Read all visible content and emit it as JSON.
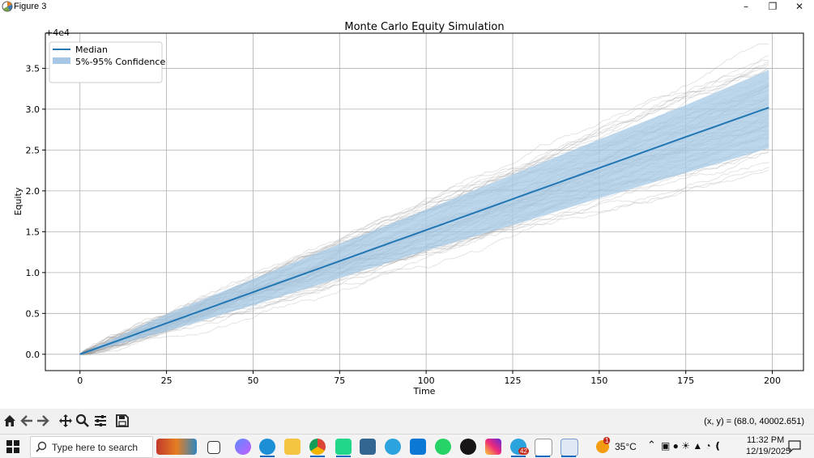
{
  "window": {
    "title": "Figure 3",
    "controls": [
      "minimize",
      "restore",
      "close"
    ]
  },
  "chart_data": {
    "type": "line",
    "title": "Monte Carlo Equity Simulation",
    "xlabel": "Time",
    "ylabel": "Equity",
    "offset_label": "+4e4",
    "xlim": [
      -10,
      209
    ],
    "ylim": [
      -0.2,
      3.93
    ],
    "xticks": [
      0,
      25,
      50,
      75,
      100,
      125,
      150,
      175,
      200
    ],
    "yticks": [
      0.0,
      0.5,
      1.0,
      1.5,
      2.0,
      2.5,
      3.0,
      3.5
    ],
    "xtick_labels": [
      "0",
      "25",
      "50",
      "75",
      "100",
      "125",
      "150",
      "175",
      "200"
    ],
    "ytick_labels": [
      "0.0",
      "0.5",
      "1.0",
      "1.5",
      "2.0",
      "2.5",
      "3.0",
      "3.5"
    ],
    "grid": true,
    "legend": {
      "placement": "top-left",
      "entries": [
        "Median",
        "5%-95% Confidence"
      ]
    },
    "series": [
      {
        "name": "Median",
        "x": [
          0,
          25,
          50,
          75,
          100,
          125,
          150,
          175,
          199
        ],
        "values": [
          0.0,
          0.38,
          0.76,
          1.14,
          1.52,
          1.9,
          2.28,
          2.66,
          3.02
        ]
      },
      {
        "name": "5%-95% Confidence",
        "x": [
          0,
          25,
          50,
          75,
          100,
          125,
          150,
          175,
          199
        ],
        "lower": [
          0.0,
          0.28,
          0.6,
          0.93,
          1.27,
          1.58,
          1.91,
          2.22,
          2.52
        ],
        "upper": [
          0.0,
          0.49,
          0.92,
          1.35,
          1.77,
          2.2,
          2.63,
          3.05,
          3.48
        ]
      }
    ],
    "colors": {
      "median": "#1f77b4",
      "band": "#a6c8e6",
      "paths": "#999999"
    },
    "n_paths": 60
  },
  "toolbar": {
    "buttons": [
      "home-icon",
      "back-icon",
      "forward-icon",
      "pan-icon",
      "zoom-icon",
      "configure-icon",
      "save-icon"
    ],
    "coords_text": "(x, y) = (68.0, 40002.651)"
  },
  "taskbar": {
    "search_placeholder": "Type here to search",
    "temperature": "35°C",
    "time": "11:32 PM",
    "date": "12/19/2025",
    "badge_count": "42",
    "weather_badge": "1"
  }
}
